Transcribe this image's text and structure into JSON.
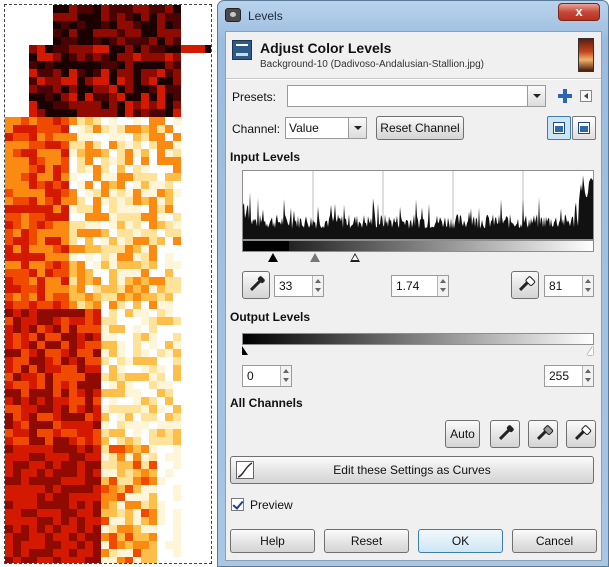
{
  "window": {
    "title": "Levels",
    "close_glyph": "x"
  },
  "header": {
    "title": "Adjust Color Levels",
    "subtitle": "Background-10 (Dadivoso-Andalusian-Stallion.jpg)",
    "icon": "levels-icon",
    "thumbnail": "image-thumbnail"
  },
  "presets": {
    "label": "Presets:",
    "value": "",
    "add_icon": "plus-icon",
    "menu_icon": "triangle-left-icon"
  },
  "channel": {
    "label": "Channel:",
    "value": "Value",
    "reset_label": "Reset Channel",
    "linear_icon": "linear-histogram-icon",
    "log_icon": "logarithmic-histogram-icon"
  },
  "input_levels": {
    "heading": "Input Levels",
    "low": "33",
    "gamma": "1.74",
    "high": "81"
  },
  "output_levels": {
    "heading": "Output Levels",
    "low": "0",
    "high": "255"
  },
  "all_channels": {
    "heading": "All Channels",
    "auto_label": "Auto"
  },
  "curves_button": "Edit these Settings as Curves",
  "preview": {
    "label": "Preview",
    "checked": true
  },
  "buttons": {
    "help": "Help",
    "reset": "Reset",
    "ok": "OK",
    "cancel": "Cancel"
  },
  "colors": {
    "window_frame": "#a9c6e3",
    "close_button": "#c6483a",
    "dialog_bg": "#f0f0f0"
  }
}
